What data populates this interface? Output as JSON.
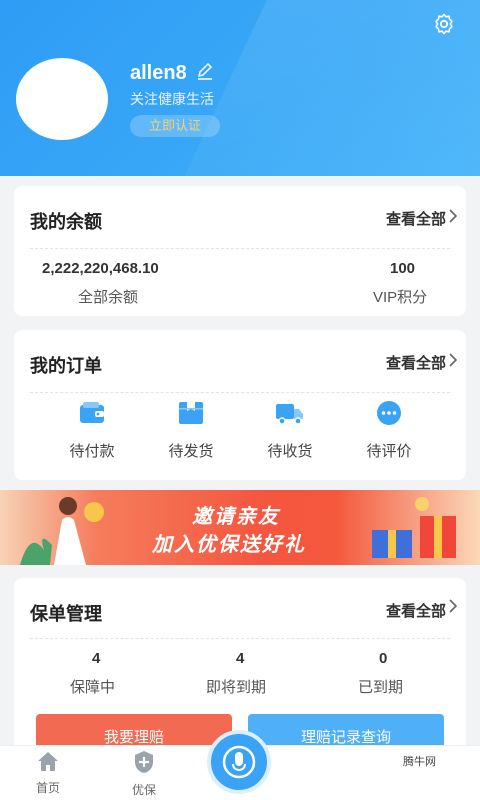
{
  "profile": {
    "username": "allen8",
    "bio": "关注健康生活",
    "verify_label": "立即认证"
  },
  "balance": {
    "title": "我的余额",
    "view_all": "查看全部",
    "total_value": "2,222,220,468.10",
    "total_label": "全部余额",
    "points_value": "100",
    "points_label": "VIP积分"
  },
  "orders": {
    "title": "我的订单",
    "view_all": "查看全部",
    "items": [
      {
        "label": "待付款",
        "icon": "wallet-icon"
      },
      {
        "label": "待发货",
        "icon": "box-icon"
      },
      {
        "label": "待收货",
        "icon": "truck-icon"
      },
      {
        "label": "待评价",
        "icon": "chat-bubble-icon"
      }
    ]
  },
  "banner": {
    "line1": "邀请亲友",
    "line2": "加入优保送好礼"
  },
  "policy": {
    "title": "保单管理",
    "view_all": "查看全部",
    "stats": [
      {
        "value": "4",
        "label": "保障中"
      },
      {
        "value": "4",
        "label": "即将到期"
      },
      {
        "value": "0",
        "label": "已到期"
      }
    ],
    "claim_label": "我要理赔",
    "records_label": "理赔记录查询"
  },
  "tabbar": {
    "items": [
      {
        "label": "首页",
        "icon": "home-icon"
      },
      {
        "label": "优保",
        "icon": "shield-plus-icon"
      }
    ]
  },
  "watermark": "腾牛网",
  "colors": {
    "primary": "#3aa3f5",
    "accent_red": "#f4563f",
    "verify_text": "#f3d27a"
  }
}
